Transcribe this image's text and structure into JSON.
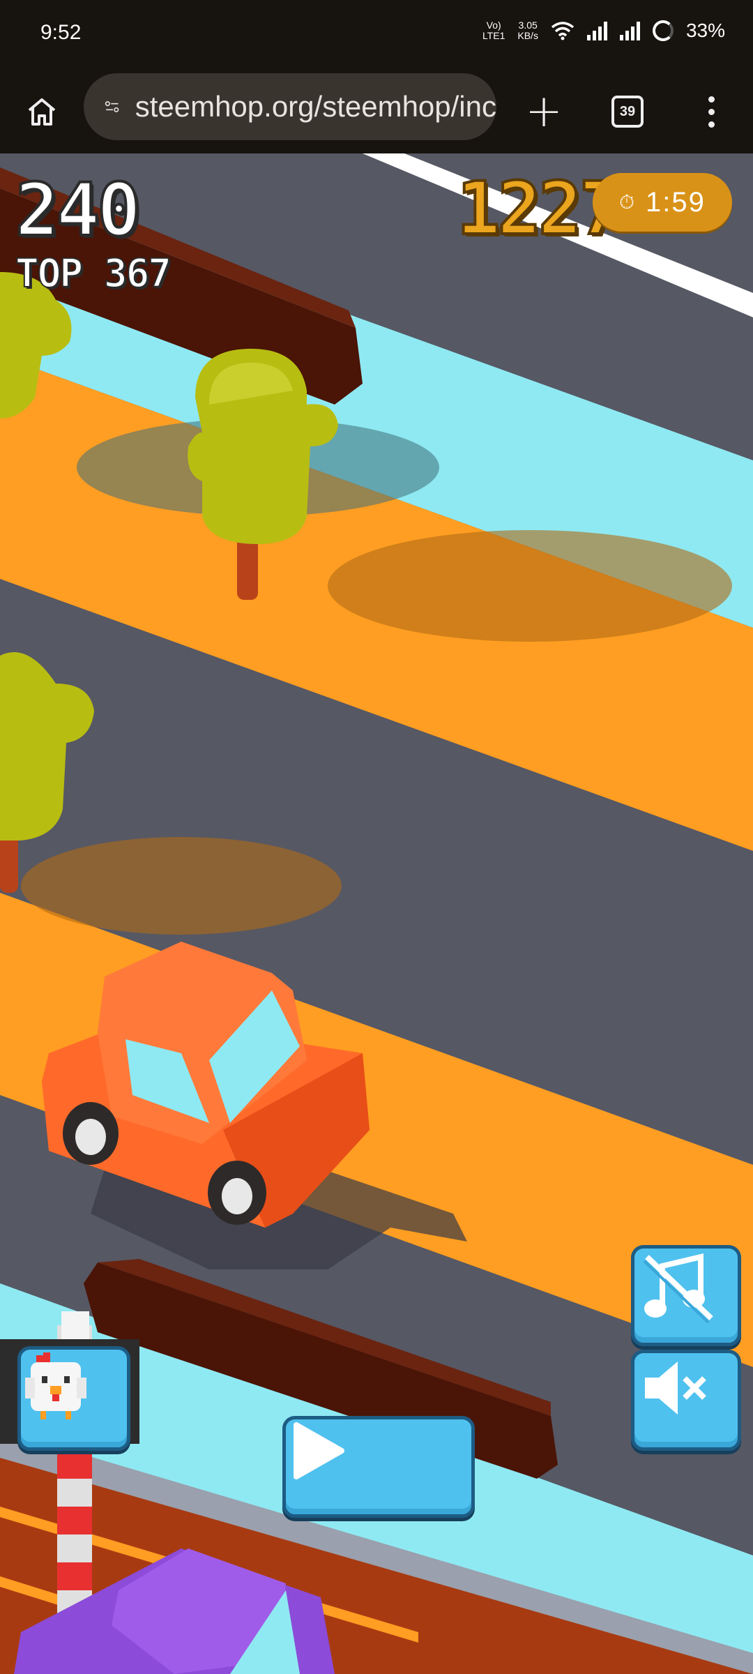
{
  "status_bar": {
    "time": "9:52",
    "net_top": "Vo)",
    "net_bottom": "LTE1",
    "speed_top": "3.05",
    "speed_bottom": "KB/s",
    "battery": "33%"
  },
  "browser": {
    "url": "steemhop.org/steemhop/inc",
    "tab_count": "39",
    "new_tab_label": "+"
  },
  "game": {
    "score": "240",
    "top_label": "TOP 367",
    "coins": "1227",
    "timer": "1:59"
  },
  "icons": [
    "home-icon",
    "site-info-icon",
    "new-tab-icon",
    "tabs-icon",
    "menu-icon",
    "timer-icon",
    "music-off-icon",
    "sound-mute-icon",
    "chicken-character-icon",
    "play-icon"
  ],
  "colors": {
    "road": "#565864",
    "water": "#8fe9f2",
    "grass": "#ff9e22",
    "button": "#4fc1ee",
    "car": "#ff6a2a",
    "coins": "#eba51e"
  }
}
